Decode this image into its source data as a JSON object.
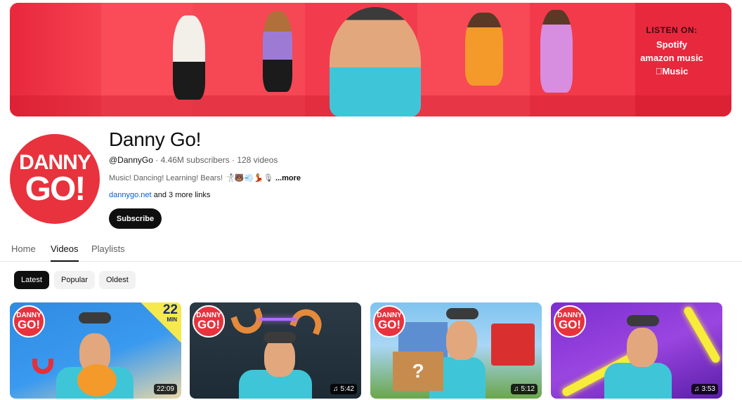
{
  "banner": {
    "listen_title": "LISTEN ON:",
    "services": [
      "Spotify",
      "amazon music",
      "Music"
    ]
  },
  "channel": {
    "avatar_line1": "DANNY",
    "avatar_line2": "GO!",
    "name": "Danny Go!",
    "handle": "@DannyGo",
    "subscribers": "4.46M subscribers",
    "videos": "128 videos",
    "description": "Music! Dancing! Learning! Bears! 🤺🐻💨💃🎙",
    "more": "...more",
    "link": "dannygo.net",
    "more_links": "and 3 more links",
    "subscribe_label": "Subscribe"
  },
  "tabs": [
    {
      "label": "Home"
    },
    {
      "label": "Videos"
    },
    {
      "label": "Playlists"
    }
  ],
  "chips": [
    {
      "label": "Latest"
    },
    {
      "label": "Popular"
    },
    {
      "label": "Oldest"
    }
  ],
  "videos": [
    {
      "duration": "22:09",
      "badge_number": "22",
      "badge_unit": "MIN",
      "logo1": "DANNY",
      "logo2": "GO!"
    },
    {
      "duration": "5:42",
      "logo1": "DANNY",
      "logo2": "GO!"
    },
    {
      "duration": "5:12",
      "logo1": "DANNY",
      "logo2": "GO!"
    },
    {
      "duration": "3:53",
      "logo1": "DANNY",
      "logo2": "GO!"
    }
  ],
  "colors": {
    "brand_red": "#e8323d",
    "link_blue": "#065fd4",
    "shirt_teal": "#3ec6d8"
  }
}
